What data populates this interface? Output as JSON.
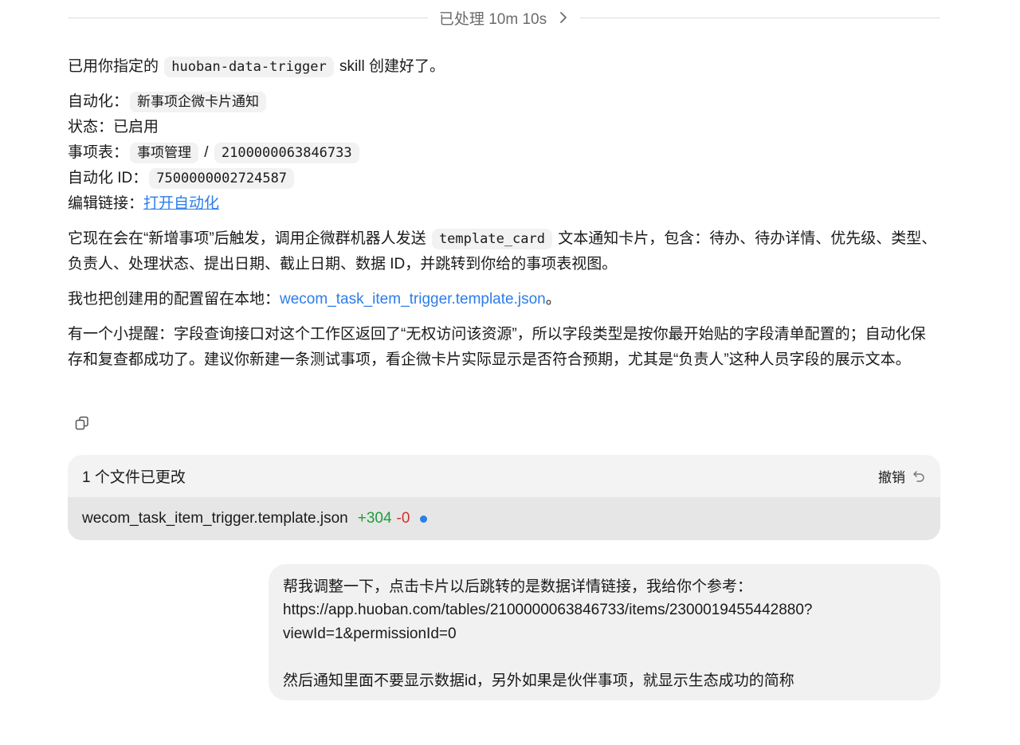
{
  "processed": {
    "label": "已处理 10m 10s"
  },
  "message": {
    "intro_prefix": "已用你指定的",
    "intro_code": "huoban-data-trigger",
    "intro_suffix": "skill 创建好了。",
    "automation_label": "自动化：",
    "automation_value": "新事项企微卡片通知",
    "status_label": "状态：",
    "status_value": "已启用",
    "table_label": "事项表：",
    "table_name": "事项管理",
    "table_sep": "/",
    "table_id": "2100000063846733",
    "automation_id_label": "自动化 ID：",
    "automation_id_value": "7500000002724587",
    "edit_link_label": "编辑链接：",
    "edit_link_text": "打开自动化",
    "desc_prefix": "它现在会在“新增事项”后触发，调用企微群机器人发送",
    "desc_code": "template_card",
    "desc_suffix": "文本通知卡片，包含：待办、待办详情、优先级、类型、负责人、处理状态、提出日期、截止日期、数据 ID，并跳转到你给的事项表视图。",
    "config_prefix": "我也把创建用的配置留在本地：",
    "config_link": "wecom_task_item_trigger.template.json",
    "config_suffix": "。",
    "reminder": "有一个小提醒：字段查询接口对这个工作区返回了“无权访问该资源”，所以字段类型是按你最开始贴的字段清单配置的；自动化保存和复查都成功了。建议你新建一条测试事项，看企微卡片实际显示是否符合预期，尤其是“负责人”这种人员字段的展示文本。"
  },
  "copy_icon": "copy-icon",
  "changes": {
    "title": "1 个文件已更改",
    "undo_label": "撤销",
    "undo_icon": "undo-icon",
    "files": [
      {
        "name": "wecom_task_item_trigger.template.json",
        "added": "+304",
        "removed": "-0"
      }
    ]
  },
  "user_message": {
    "text": "帮我调整一下，点击卡片以后跳转的是数据详情链接，我给你个参考：\nhttps://app.huoban.com/tables/2100000063846733/items/2300019455442880?\nviewId=1&permissionId=0\n\n然后通知里面不要显示数据id，另外如果是伙伴事项，就显示生态成功的简称"
  },
  "colors": {
    "link": "#2b7de9",
    "added": "#1f9d3a",
    "removed": "#d0312d",
    "status_dot": "#2b7de9"
  }
}
